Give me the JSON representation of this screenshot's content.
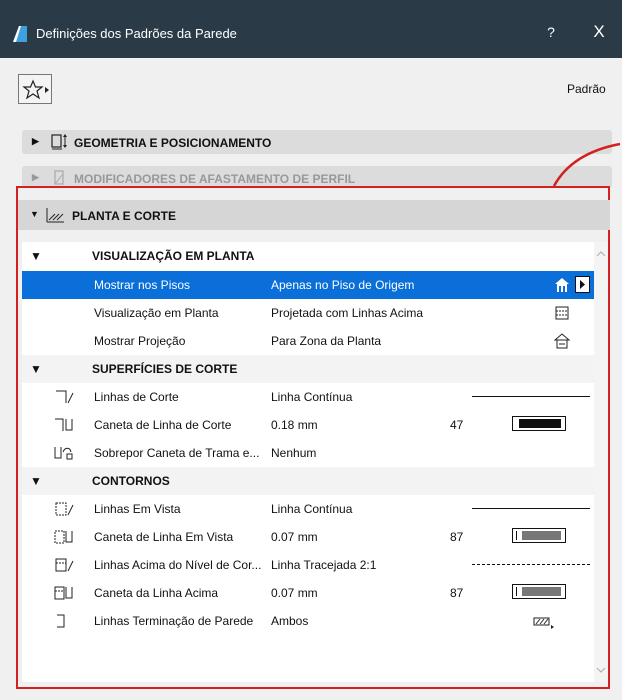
{
  "window": {
    "title": "Definições dos Padrões da Parede",
    "help": "?",
    "close": "X"
  },
  "toolbar": {
    "favorites_icon": "star-icon",
    "default_label": "Padrão"
  },
  "sections": [
    {
      "label": "GEOMETRIA E POSICIONAMENTO",
      "icon": "geometry-icon",
      "expanded": false
    },
    {
      "label": "MODIFICADORES DE AFASTAMENTO DE PERFIL",
      "icon": "profile-modifier-icon",
      "expanded": false,
      "disabled": true
    },
    {
      "label": "PLANTA E CORTE",
      "icon": "floor-plan-section-icon",
      "expanded": true
    }
  ],
  "groups": {
    "visualizacao": "VISUALIZAÇÃO EM PLANTA",
    "superficies": "SUPERFÍCIES DE CORTE",
    "contornos": "CONTORNOS"
  },
  "rows": [
    {
      "label": "Mostrar nos Pisos",
      "value": "Apenas no Piso de Origem",
      "icon": "home-story-icon",
      "selected": true
    },
    {
      "label": "Visualização em Planta",
      "value": "Projetada com Linhas Acima",
      "icon": "projected-icon"
    },
    {
      "label": "Mostrar Projeção",
      "value": "Para Zona da Planta",
      "icon": "projection-zone-icon"
    },
    {
      "label": "Linhas de Corte",
      "value": "Linha Contínua",
      "icon": "cut-line-icon"
    },
    {
      "label": "Caneta de Linha de Corte",
      "value": "0.18 mm",
      "number": "47",
      "icon": "cut-pen-icon"
    },
    {
      "label": "Sobrepor Caneta de Trama e...",
      "value": "Nenhum",
      "icon": "override-pen-icon"
    },
    {
      "label": "Linhas Em Vista",
      "value": "Linha Contínua",
      "icon": "view-line-icon"
    },
    {
      "label": "Caneta de Linha Em Vista",
      "value": "0.07 mm",
      "number": "87",
      "icon": "view-pen-icon"
    },
    {
      "label": "Linhas Acima do Nível de Cor...",
      "value": "Linha Tracejada 2:1",
      "icon": "overhead-line-icon"
    },
    {
      "label": "Caneta da Linha Acima",
      "value": "0.07 mm",
      "number": "87",
      "icon": "overhead-pen-icon"
    },
    {
      "label": "Linhas Terminação de Parede",
      "value": "Ambos",
      "icon": "wall-end-icon"
    }
  ],
  "colors": {
    "selection": "#0a6fd9",
    "highlight_border": "#d32020",
    "titlebar": "#2b3a47"
  }
}
